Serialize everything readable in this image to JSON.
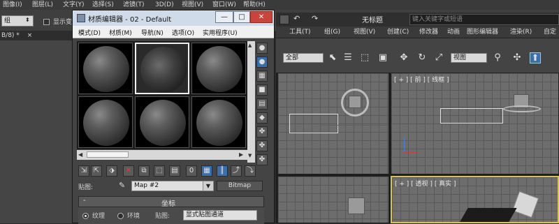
{
  "app_menu": [
    "图像(I)",
    "图层(L)",
    "文字(Y)",
    "选择(S)",
    "滤镜(T)",
    "3D(D)",
    "视图(V)",
    "窗口(W)",
    "帮助(H)"
  ],
  "left": {
    "group_select": "组",
    "checkbox_label": "显示变",
    "doc_tab": "B/8) *"
  },
  "max_app": {
    "title": "无标题",
    "search_placeholder": "键入关键字或短语",
    "menus": [
      "工具(T)",
      "组(G)",
      "视图(V)",
      "创建(C)",
      "修改器",
      "动画",
      "图形编辑器",
      "渲染(R)",
      "自定"
    ],
    "selection_filter": "全部",
    "ref_coord": "视图",
    "viewports": {
      "top_left_label": "",
      "front_label": "[ + ] [ 前 ] [ 线框 ]",
      "bottom_left_label": "",
      "perspective_label": "[ + ] [ 透视 ] [ 真实 ]"
    }
  },
  "material_editor": {
    "title": "材质编辑器 - 02 - Default",
    "win_buttons": {
      "minimize": "—",
      "restore": "□",
      "close": "✕"
    },
    "menus": [
      "模式(D)",
      "材质(M)",
      "导航(N)",
      "选项(O)",
      "实用程序(U)"
    ],
    "slots": [
      {
        "active": false
      },
      {
        "active": true
      },
      {
        "active": false
      },
      {
        "active": false
      },
      {
        "active": false
      },
      {
        "active": false
      }
    ],
    "map_label": "贴图:",
    "map_name": "Map #2",
    "map_type_button": "Bitmap",
    "rollout_title": "坐标",
    "rollout_toggle": "-",
    "radio_texture": "纹理",
    "radio_environ": "环境",
    "mapping_label": "贴图:",
    "mapping_value": "显式贴图通道"
  },
  "colors": {
    "title_bar": "#cfdbe8",
    "close_button": "#c9443a",
    "viewport_bg": "#6d6d6d",
    "active_viewport_border": "#d8c25a"
  }
}
